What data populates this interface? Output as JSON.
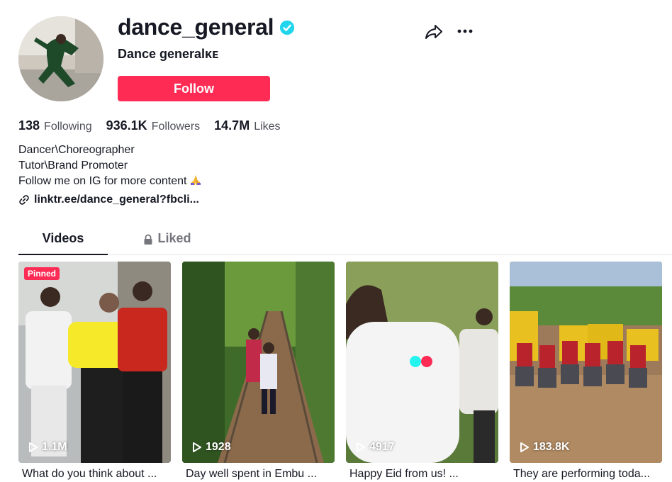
{
  "profile": {
    "username": "dance_general",
    "nickname": "Dance generalᴋᴇ",
    "follow_label": "Follow",
    "verified": true
  },
  "stats": [
    {
      "value": "138",
      "label": "Following"
    },
    {
      "value": "936.1K",
      "label": "Followers"
    },
    {
      "value": "14.7M",
      "label": "Likes"
    }
  ],
  "bio": {
    "lines": [
      "Dancer\\Choreographer",
      "Tutor\\Brand Promoter",
      "Follow me on IG for more content"
    ],
    "link": "linktr.ee/dance_general?fbcli..."
  },
  "tabs": [
    {
      "label": "Videos",
      "active": true
    },
    {
      "label": "Liked",
      "active": false,
      "locked": true
    }
  ],
  "videos": [
    {
      "views": "1.1M",
      "caption": "What do you think about ...",
      "pinned_label": "Pinned"
    },
    {
      "views": "1928",
      "caption": "Day well spent in Embu ..."
    },
    {
      "views": "4917",
      "caption": "Happy Eid from us! ..."
    },
    {
      "views": "183.8K",
      "caption": "They are performing toda..."
    }
  ],
  "colors": {
    "accent": "#fe2c55",
    "verified": "#20d5ec",
    "text": "#161823",
    "muted": "#4e5058"
  },
  "icons": [
    "verified-badge-icon",
    "share-icon",
    "more-icon",
    "link-icon",
    "lock-icon",
    "play-icon",
    "praying-hands-emoji"
  ]
}
